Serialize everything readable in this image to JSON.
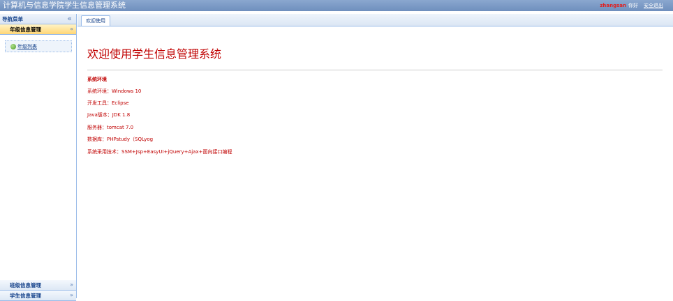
{
  "app": {
    "title": "计算机与信息学院学生信息管理系统"
  },
  "user": {
    "name": "zhangsan",
    "greeting": "你好",
    "logout": "安全退出"
  },
  "sidebar": {
    "header": "导航菜单",
    "collapse_icon": "«",
    "sections": [
      {
        "label": "年级信息管理",
        "chevron": "«",
        "active": true
      },
      {
        "label": "班级信息管理",
        "chevron": "»"
      },
      {
        "label": "学生信息管理",
        "chevron": "»"
      }
    ],
    "items": [
      {
        "label": "年级列表",
        "icon": "globe-icon"
      }
    ]
  },
  "tabs": [
    {
      "label": "欢迎使用"
    }
  ],
  "welcome": {
    "heading": "欢迎使用学生信息管理系统",
    "env_title": "系统环境",
    "lines": [
      "系统环境：Windows 10",
      "开发工具：Eclipse",
      "Java版本：JDK 1.8",
      "服务器：tomcat 7.0",
      "数据库：PHPstudy（SQLyog",
      "系统采用技术：SSM+Jsp+EasyUI+jQuery+Ajax+面向接口编程"
    ]
  },
  "colors": {
    "accent": "#c00000",
    "header_bg": "#7f9ccb",
    "border": "#99bbe8",
    "active_section": "#ffd676"
  }
}
